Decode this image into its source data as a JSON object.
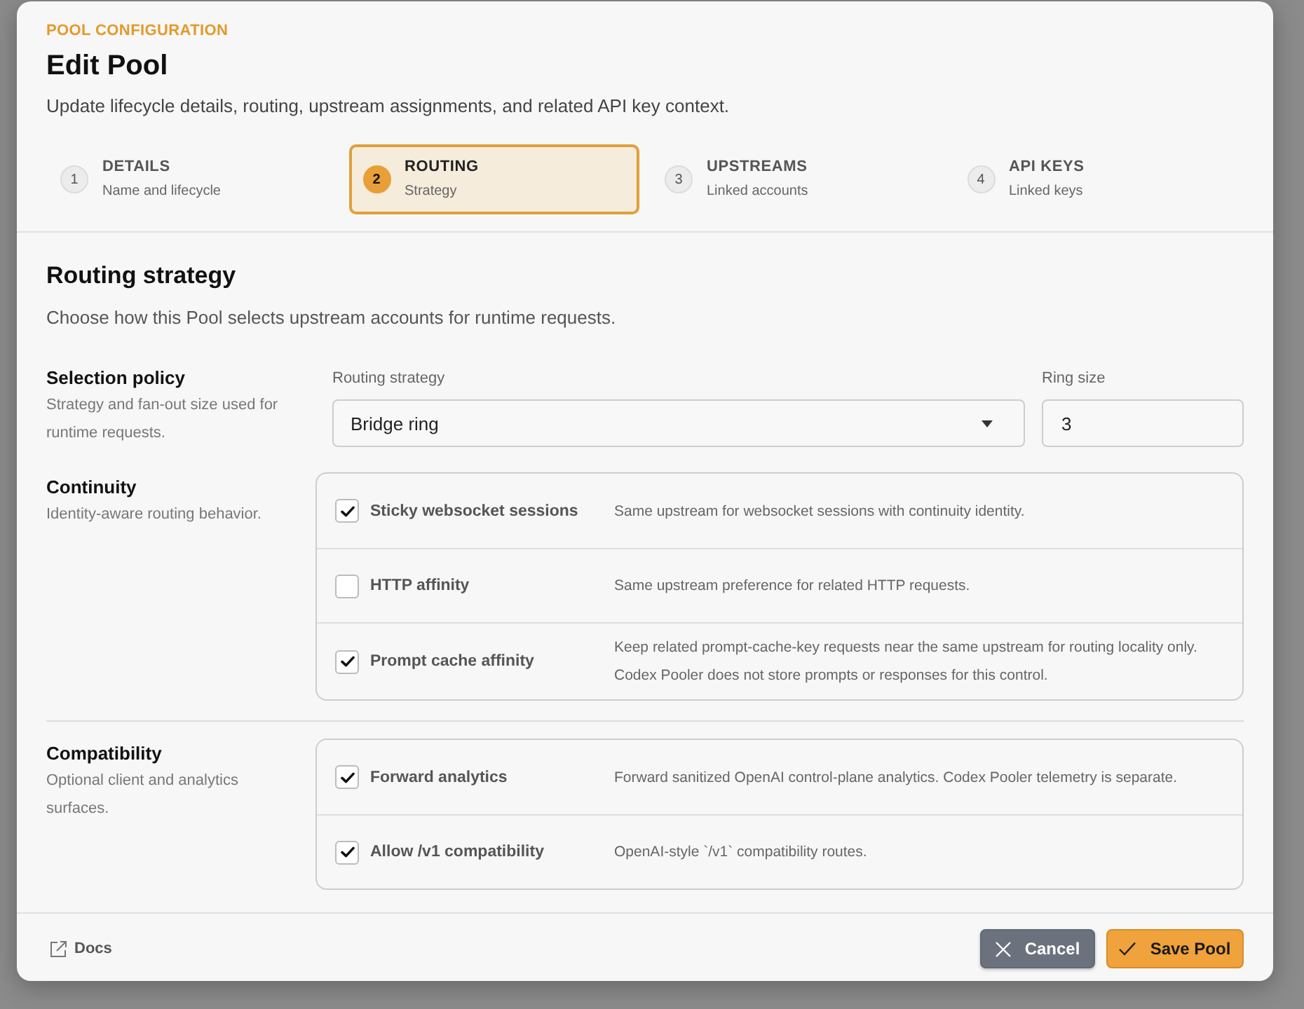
{
  "header": {
    "eyebrow": "POOL CONFIGURATION",
    "title": "Edit Pool",
    "subtitle": "Update lifecycle details, routing, upstream assignments, and related API key context."
  },
  "steps": [
    {
      "number": "1",
      "label": "DETAILS",
      "caption": "Name and lifecycle",
      "selected": false
    },
    {
      "number": "2",
      "label": "ROUTING",
      "caption": "Strategy",
      "selected": true
    },
    {
      "number": "3",
      "label": "UPSTREAMS",
      "caption": "Linked accounts",
      "selected": false
    },
    {
      "number": "4",
      "label": "API KEYS",
      "caption": "Linked keys",
      "selected": false
    }
  ],
  "section": {
    "title": "Routing strategy",
    "description": "Choose how this Pool selects upstream accounts for runtime requests."
  },
  "groups": [
    {
      "kind": "fields",
      "title": "Selection policy",
      "description": "Strategy and fan-out size used for runtime requests.",
      "fields": [
        {
          "kind": "select",
          "label": "Routing strategy",
          "value": "Bridge ring"
        },
        {
          "kind": "text",
          "label": "Ring size",
          "value": "3"
        }
      ]
    },
    {
      "kind": "options",
      "title": "Continuity",
      "description": "Identity-aware routing behavior.",
      "options": [
        {
          "label": "Sticky websocket sessions",
          "description": "Same upstream for websocket sessions with continuity identity.",
          "checked": true
        },
        {
          "label": "HTTP affinity",
          "description": "Same upstream preference for related HTTP requests.",
          "checked": false
        },
        {
          "label": "Prompt cache affinity",
          "description": "Keep related prompt-cache-key requests near the same upstream for routing locality only. Codex Pooler does not store prompts or responses for this control.",
          "checked": true
        }
      ]
    },
    {
      "kind": "options",
      "title": "Compatibility",
      "description": "Optional client and analytics surfaces.",
      "options": [
        {
          "label": "Forward analytics",
          "description": "Forward sanitized OpenAI control-plane analytics. Codex Pooler telemetry is separate.",
          "checked": true
        },
        {
          "label": "Allow /v1 compatibility",
          "description": "OpenAI-style `/v1` compatibility routes.",
          "checked": true
        }
      ]
    }
  ],
  "footer": {
    "docs_link": "Docs",
    "buttons": [
      {
        "kind": "secondary",
        "label": "Cancel"
      },
      {
        "kind": "primary",
        "label": "Save Pool"
      }
    ]
  }
}
